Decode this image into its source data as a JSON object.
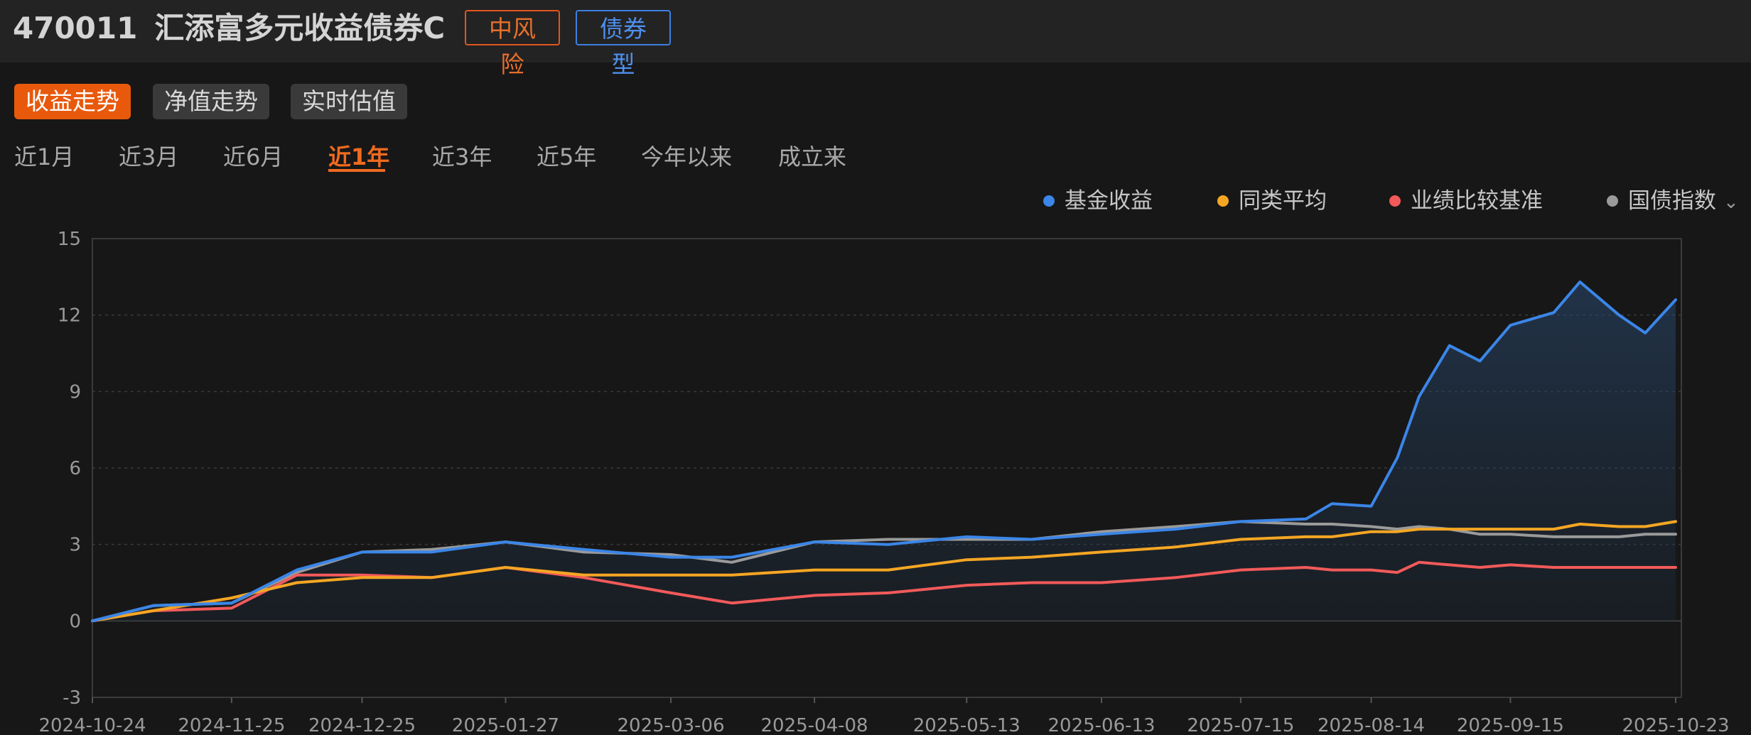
{
  "header": {
    "code": "470011",
    "name": "汇添富多元收益债券C",
    "risk_badge": "中风险",
    "type_badge": "债券型"
  },
  "view_tabs": [
    {
      "label": "收益走势",
      "active": true
    },
    {
      "label": "净值走势",
      "active": false
    },
    {
      "label": "实时估值",
      "active": false
    }
  ],
  "range_tabs": [
    {
      "label": "近1月",
      "active": false
    },
    {
      "label": "近3月",
      "active": false
    },
    {
      "label": "近6月",
      "active": false
    },
    {
      "label": "近1年",
      "active": true
    },
    {
      "label": "近3年",
      "active": false
    },
    {
      "label": "近5年",
      "active": false
    },
    {
      "label": "今年以来",
      "active": false
    },
    {
      "label": "成立来",
      "active": false
    }
  ],
  "legend": [
    {
      "label": "基金收益",
      "color": "#3b86e8",
      "icon": "dot-icon"
    },
    {
      "label": "同类平均",
      "color": "#f5a623",
      "icon": "dot-icon"
    },
    {
      "label": "业绩比较基准",
      "color": "#f25a5a",
      "icon": "dot-icon"
    },
    {
      "label": "国债指数",
      "color": "#9a9a9a",
      "icon": "dot-icon",
      "dropdown_icon": "chevron-down-icon"
    }
  ],
  "chart_data": {
    "type": "line",
    "ylim": [
      -3,
      15
    ],
    "yticks": [
      15,
      12,
      9,
      6,
      3,
      0,
      -3
    ],
    "xticks": [
      "2024-10-24",
      "2024-11-25",
      "2024-12-25",
      "2025-01-27",
      "2025-03-06",
      "2025-04-08",
      "2025-05-13",
      "2025-06-13",
      "2025-07-15",
      "2025-08-14",
      "2025-09-15",
      "2025-10-23"
    ],
    "grid": "horizontal dashed",
    "legend_position": "top-right",
    "x": [
      "2024-10-24",
      "2024-11-07",
      "2024-11-25",
      "2024-12-10",
      "2024-12-25",
      "2025-01-10",
      "2025-01-27",
      "2025-02-14",
      "2025-03-06",
      "2025-03-20",
      "2025-04-08",
      "2025-04-25",
      "2025-05-13",
      "2025-05-28",
      "2025-06-13",
      "2025-06-30",
      "2025-07-15",
      "2025-07-30",
      "2025-08-05",
      "2025-08-14",
      "2025-08-20",
      "2025-08-25",
      "2025-09-01",
      "2025-09-08",
      "2025-09-15",
      "2025-09-25",
      "2025-10-01",
      "2025-10-10",
      "2025-10-16",
      "2025-10-23"
    ],
    "series": [
      {
        "name": "基金收益",
        "color": "#3b86e8",
        "values": [
          0,
          0.6,
          0.7,
          2.0,
          2.7,
          2.7,
          3.1,
          2.8,
          2.5,
          2.5,
          3.1,
          3.0,
          3.3,
          3.2,
          3.4,
          3.6,
          3.9,
          4.0,
          4.6,
          4.5,
          6.4,
          8.8,
          10.8,
          10.2,
          11.6,
          12.1,
          13.3,
          12.0,
          11.3,
          12.6
        ]
      },
      {
        "name": "同类平均",
        "color": "#f5a623",
        "values": [
          0,
          0.4,
          0.9,
          1.5,
          1.7,
          1.7,
          2.1,
          1.8,
          1.8,
          1.8,
          2.0,
          2.0,
          2.4,
          2.5,
          2.7,
          2.9,
          3.2,
          3.3,
          3.3,
          3.5,
          3.5,
          3.6,
          3.6,
          3.6,
          3.6,
          3.6,
          3.8,
          3.7,
          3.7,
          3.9
        ]
      },
      {
        "name": "业绩比较基准",
        "color": "#f25a5a",
        "values": [
          0,
          0.4,
          0.5,
          1.8,
          1.8,
          1.7,
          2.1,
          1.7,
          1.1,
          0.7,
          1.0,
          1.1,
          1.4,
          1.5,
          1.5,
          1.7,
          2.0,
          2.1,
          2.0,
          2.0,
          1.9,
          2.3,
          2.2,
          2.1,
          2.2,
          2.1,
          2.1,
          2.1,
          2.1,
          2.1
        ]
      },
      {
        "name": "国债指数",
        "color": "#9a9a9a",
        "values": [
          0,
          0.6,
          0.7,
          1.9,
          2.7,
          2.8,
          3.1,
          2.7,
          2.6,
          2.3,
          3.1,
          3.2,
          3.2,
          3.2,
          3.5,
          3.7,
          3.9,
          3.8,
          3.8,
          3.7,
          3.6,
          3.7,
          3.6,
          3.4,
          3.4,
          3.3,
          3.3,
          3.3,
          3.4,
          3.4
        ]
      }
    ]
  }
}
